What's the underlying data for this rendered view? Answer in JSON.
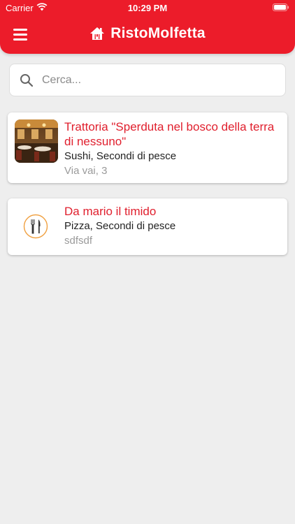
{
  "status_bar": {
    "carrier": "Carrier",
    "time": "10:29 PM"
  },
  "header": {
    "title": "RistoMolfetta"
  },
  "search": {
    "placeholder": "Cerca..."
  },
  "restaurants": [
    {
      "name": "Trattoria \"Sperduta nel bosco della terra di nessuno\"",
      "categories": "Sushi, Secondi di pesce",
      "address": "Via vai, 3",
      "thumbnail": "restaurant-interior-photo"
    },
    {
      "name": "Da mario il timido",
      "categories": "Pizza, Secondi di pesce",
      "address": "sdfsdf",
      "thumbnail": "fork-knife-icon"
    }
  ],
  "colors": {
    "accent": "#ec1c2a",
    "title_red": "#e01f2d",
    "background": "#eeeeee"
  }
}
